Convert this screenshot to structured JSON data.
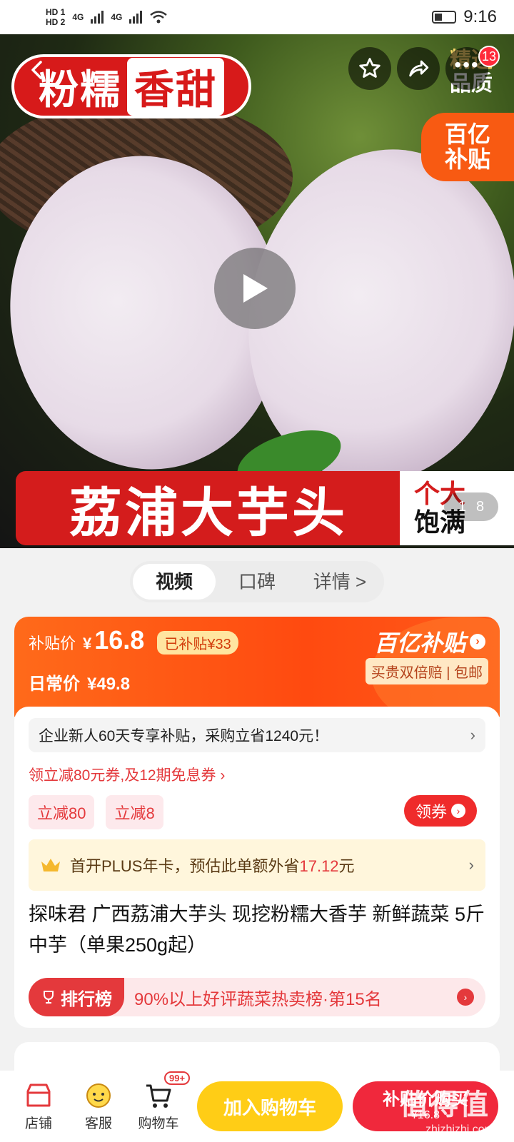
{
  "status_bar": {
    "time": "9:16",
    "hd1": "HD 1",
    "hd2": "HD 2",
    "net1": "4G",
    "net2": "4G"
  },
  "hero": {
    "badge_part1": "粉糯",
    "badge_part2": "香甜",
    "quality_line1": "精选",
    "quality_line2": "品质",
    "yi_line1": "百亿",
    "yi_line2": "补贴",
    "banner_title": "荔浦大芋头",
    "banner_side_line1": "个大",
    "banner_side_line2": "饱满",
    "page_current": "1",
    "page_total": "8",
    "notification_count": "13"
  },
  "tabs": [
    {
      "label": "视频"
    },
    {
      "label": "口碑"
    },
    {
      "label": "详情 >"
    }
  ],
  "price": {
    "subsidy_label": "补贴价",
    "currency": "¥",
    "subsidy_price": "16.8",
    "saved": "已补贴¥33",
    "daily_label": "日常价",
    "daily_price": "¥49.8",
    "brand": "百亿补贴",
    "guarantee": "买贵双倍赔 | 包邮"
  },
  "promo": {
    "enterprise": "企业新人60天专享补贴，采购立省1240元！",
    "coupon_line": "领立减80元券,及12期免息券 ›",
    "tags": [
      "立减80",
      "立减8"
    ],
    "claim_button": "领券",
    "plus_text_a": "首开PLUS年卡，预估此单额外省",
    "plus_amount": "17.12",
    "plus_text_b": "元"
  },
  "product": {
    "title": "探味君 广西荔浦大芋头 现挖粉糯大香芋 新鲜蔬菜 5斤 中芋（单果250g起）"
  },
  "ranking": {
    "badge": "排行榜",
    "text": "90%以上好评蔬菜热卖榜·第15名"
  },
  "bottom_bar": {
    "store": "店铺",
    "service": "客服",
    "cart": "购物车",
    "cart_count": "99+",
    "add_to_cart": "加入购物车",
    "buy": "补贴价购买",
    "buy_price": "¥16.8"
  },
  "watermark": {
    "text": "值得值",
    "url": "zhizhizhi.com"
  },
  "colors": {
    "accent_red": "#e4393c",
    "subsidy_orange": "#ff5a1a",
    "cart_yellow": "#ffcd16"
  }
}
